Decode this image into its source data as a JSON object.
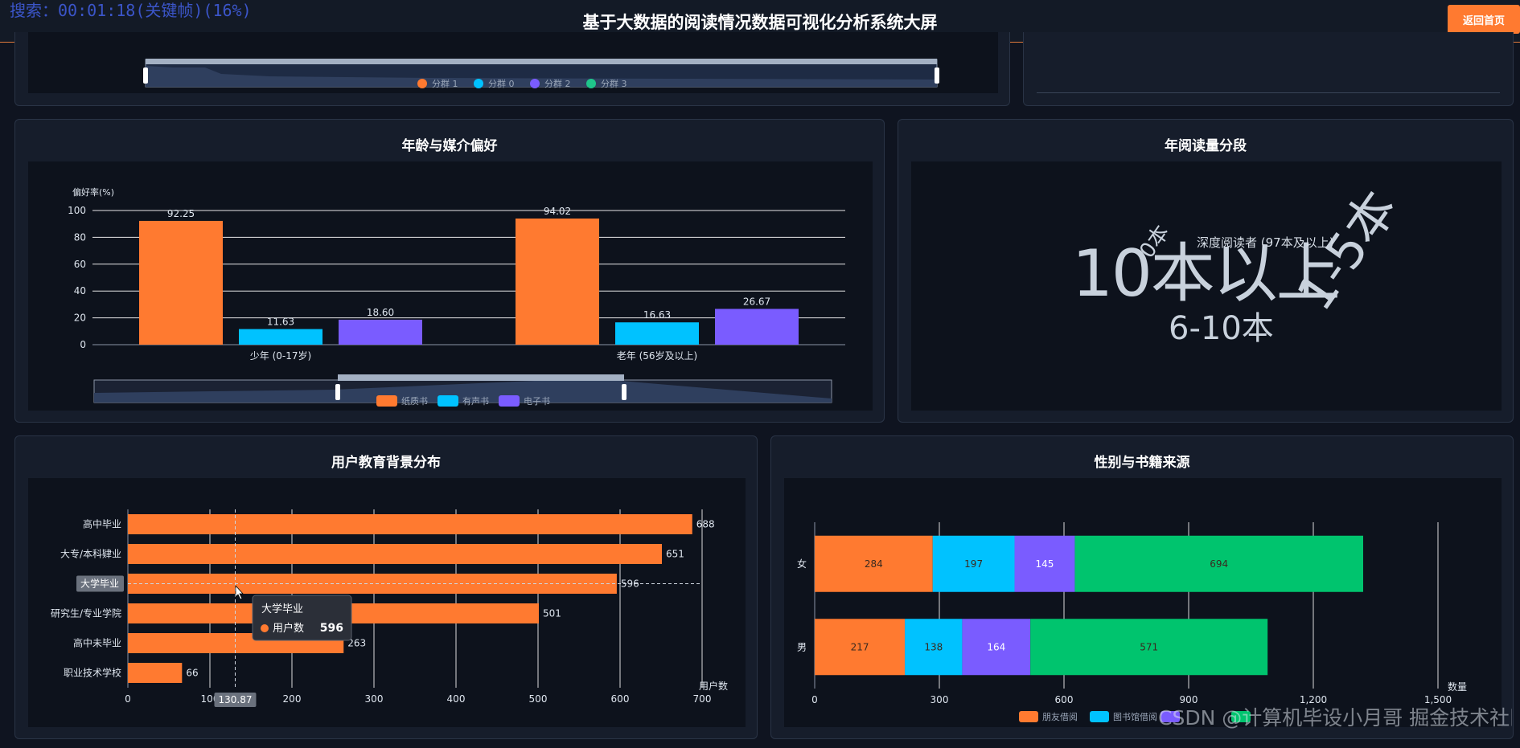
{
  "header": {
    "recording_overlay": "搜索：00:01:18(关键帧)(16%)",
    "title": "基于大数据的阅读情况数据可视化分析系统大屏",
    "back_button": "返回首页"
  },
  "top_panel": {
    "legend": [
      "分群 1",
      "分群 0",
      "分群 2",
      "分群 3"
    ],
    "legend_colors": [
      "#ff7a30",
      "#00c2ff",
      "#7a5cff",
      "#1fc58a"
    ]
  },
  "age_media": {
    "title": "年龄与媒介偏好",
    "chart_data": {
      "type": "bar",
      "ylabel": "偏好率(%)",
      "ylim": [
        0,
        100
      ],
      "yticks": [
        0,
        20,
        40,
        60,
        80,
        100
      ],
      "categories": [
        "少年 (0-17岁)",
        "老年 (56岁及以上)"
      ],
      "series": [
        {
          "name": "纸质书",
          "color": "#ff7a30",
          "values": [
            92.25,
            94.02
          ],
          "labels": [
            "92.25",
            "94.02"
          ]
        },
        {
          "name": "有声书",
          "color": "#00c2ff",
          "values": [
            11.63,
            16.63
          ],
          "labels": [
            "11.63",
            "16.63"
          ]
        },
        {
          "name": "电子书",
          "color": "#7a5cff",
          "values": [
            18.6,
            26.67
          ],
          "labels": [
            "18.60",
            "26.67"
          ]
        }
      ]
    }
  },
  "reading_volume": {
    "title": "年阅读量分段",
    "cloud_words": [
      "10本以上",
      "6-10本",
      "1-5本",
      "0本"
    ],
    "tooltip": "深度阅读者 (97本及以上)"
  },
  "education": {
    "title": "用户教育背景分布",
    "chart_data": {
      "type": "bar",
      "orientation": "horizontal",
      "xlabel": "用户数",
      "xlim": [
        0,
        700
      ],
      "xticks": [
        0,
        100,
        200,
        300,
        400,
        500,
        600,
        700
      ],
      "categories": [
        "高中毕业",
        "大专/本科肄业",
        "大学毕业",
        "研究生/专业学院",
        "高中未毕业",
        "职业技术学校"
      ],
      "values": [
        688,
        651,
        596,
        501,
        263,
        66
      ],
      "color": "#ff7a30"
    },
    "axis_pointer_x": "130.87",
    "tooltip": {
      "title": "大学毕业",
      "series": "用户数",
      "value": "596"
    }
  },
  "gender_source": {
    "title": "性别与书籍来源",
    "chart_data": {
      "type": "bar",
      "orientation": "horizontal",
      "stacked": true,
      "xlabel": "数量",
      "xlim": [
        0,
        1500
      ],
      "xticks": [
        "0",
        "300",
        "600",
        "900",
        "1,200",
        "1,500"
      ],
      "categories": [
        "女",
        "男"
      ],
      "series": [
        {
          "name": "朋友借阅",
          "color": "#ff7a30",
          "values": [
            284,
            217
          ]
        },
        {
          "name": "图书馆借阅",
          "color": "#00c2ff",
          "values": [
            197,
            138
          ]
        },
        {
          "name": "",
          "color": "#7a5cff",
          "values": [
            145,
            164
          ]
        },
        {
          "name": "",
          "color": "#00c46e",
          "values": [
            694,
            571
          ]
        }
      ]
    }
  },
  "watermark": "CSDN @计算机毕设小月哥   掘金技术社区 @ 计算机毕设小月哥"
}
